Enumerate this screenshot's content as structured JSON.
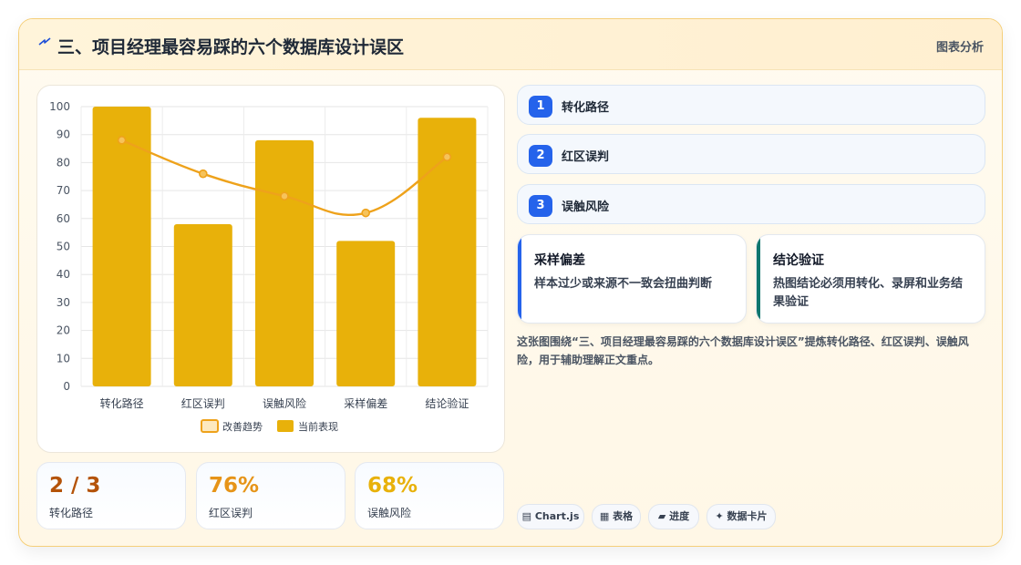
{
  "header": {
    "icon": "lightning-bolt-icon",
    "title": "三、项目经理最容易踩的六个数据库设计误区",
    "tag": "图表分析"
  },
  "colors": {
    "bar": "#e8b10a",
    "line": "#eea21b",
    "step_badge": "#2563eb",
    "accent_blue": "#2563eb",
    "accent_teal": "#0f766e"
  },
  "chart_data": {
    "type": "bar",
    "categories": [
      "转化路径",
      "红区误判",
      "误触风险",
      "采样偏差",
      "结论验证"
    ],
    "series": [
      {
        "name": "当前表现",
        "type": "bar",
        "values": [
          100,
          58,
          88,
          52,
          96
        ]
      },
      {
        "name": "改善趋势",
        "type": "line",
        "values": [
          88,
          76,
          68,
          62,
          82
        ]
      }
    ],
    "yticks": [
      "0",
      "10",
      "20",
      "30",
      "40",
      "50",
      "60",
      "70",
      "80",
      "90",
      "100"
    ],
    "ylim": [
      0,
      100
    ],
    "grid": true,
    "legend_position": "bottom"
  },
  "stats": [
    {
      "value": "2 / 3",
      "label": "转化路径",
      "color": "#b45309"
    },
    {
      "value": "76%",
      "label": "红区误判",
      "color": "#e69418"
    },
    {
      "value": "68%",
      "label": "误触风险",
      "color": "#e8b10a"
    }
  ],
  "steps": [
    {
      "num": "1",
      "label": "转化路径"
    },
    {
      "num": "2",
      "label": "红区误判"
    },
    {
      "num": "3",
      "label": "误触风险"
    }
  ],
  "features": [
    {
      "title": "采样偏差",
      "desc": "样本过少或来源不一致会扭曲判断"
    },
    {
      "title": "结论验证",
      "desc": "热图结论必须用转化、录屏和业务结果验证"
    }
  ],
  "summary": "这张图围绕“三、项目经理最容易踩的六个数据库设计误区”提炼转化路径、红区误判、误触风险，用于辅助理解正文重点。",
  "chips": [
    {
      "icon": "chart-icon",
      "label": "Chart.js"
    },
    {
      "icon": "table-icon",
      "label": "表格"
    },
    {
      "icon": "progress-icon",
      "label": "进度"
    },
    {
      "icon": "sparkle-icon",
      "label": "数据卡片"
    }
  ]
}
